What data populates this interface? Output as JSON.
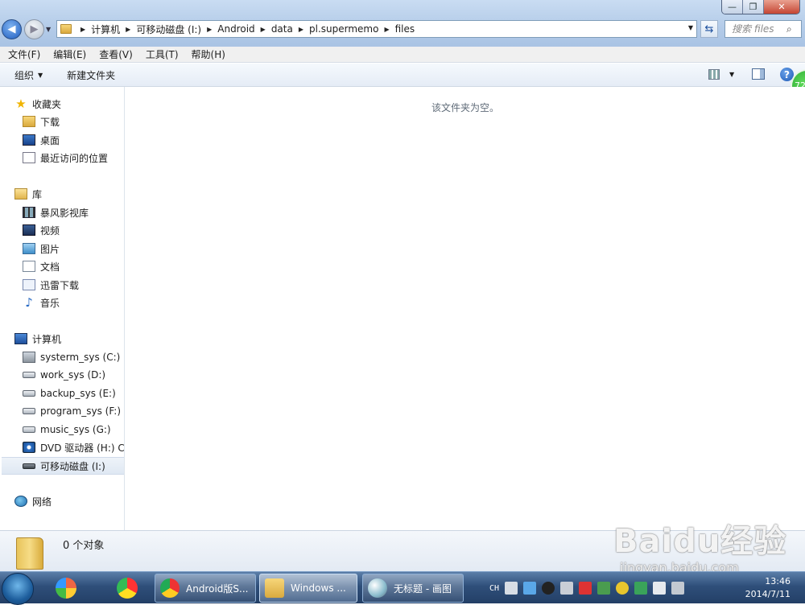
{
  "address": {
    "crumbs": [
      "计算机",
      "可移动磁盘 (I:)",
      "Android",
      "data",
      "pl.supermemo",
      "files"
    ]
  },
  "search": {
    "placeholder": "搜索 files"
  },
  "menu": [
    "文件(F)",
    "编辑(E)",
    "查看(V)",
    "工具(T)",
    "帮助(H)"
  ],
  "commands": {
    "organize": "组织",
    "new_folder": "新建文件夹"
  },
  "help_badge": "72",
  "sidebar": {
    "favorites": {
      "label": "收藏夹",
      "items": [
        "下载",
        "桌面",
        "最近访问的位置"
      ]
    },
    "libraries": {
      "label": "库",
      "items": [
        "暴风影视库",
        "视频",
        "图片",
        "文档",
        "迅雷下载",
        "音乐"
      ]
    },
    "computer": {
      "label": "计算机",
      "items": [
        "systerm_sys (C:)",
        "work_sys (D:)",
        "backup_sys (E:)",
        "program_sys (F:)",
        "music_sys (G:)",
        "DVD 驱动器 (H:) CD",
        "可移动磁盘 (I:)"
      ]
    },
    "network": {
      "label": "网络"
    }
  },
  "content": {
    "empty_message": "该文件夹为空。"
  },
  "details": {
    "count": "0 个对象"
  },
  "taskbar": {
    "tasks": [
      "Android版S...",
      "Windows ...",
      "无标题 - 画图"
    ],
    "lang": "CH",
    "time": "13:46",
    "date": "2014/7/11"
  },
  "watermark": {
    "line1": "Baidu经验",
    "line2": "jingyan.baidu.com"
  },
  "colors": {
    "titlebar": "#b9cfe9",
    "taskbar": "#2f4f7a",
    "accent": "#1d5cc0"
  }
}
